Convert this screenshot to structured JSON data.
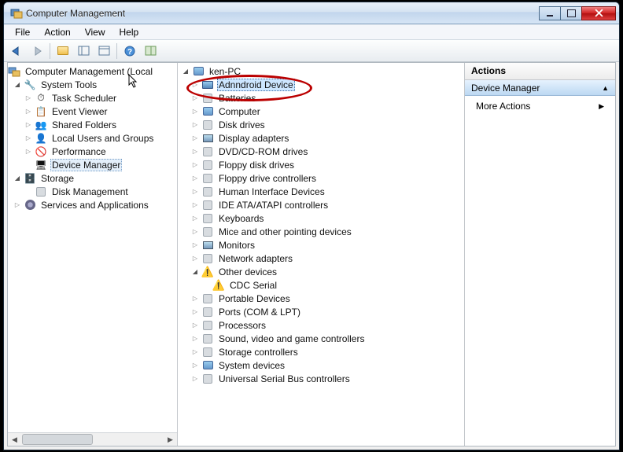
{
  "window": {
    "title": "Computer Management"
  },
  "menu": {
    "file": "File",
    "action": "Action",
    "view": "View",
    "help": "Help"
  },
  "toolbar_icons": [
    "back",
    "forward",
    "up",
    "show-hide",
    "properties",
    "refresh",
    "help",
    "topic-help"
  ],
  "left_tree": {
    "root": "Computer Management (Local",
    "system_tools": "System Tools",
    "system_children": [
      "Task Scheduler",
      "Event Viewer",
      "Shared Folders",
      "Local Users and Groups",
      "Performance",
      "Device Manager"
    ],
    "storage": "Storage",
    "disk_mgmt": "Disk Management",
    "services": "Services and Applications"
  },
  "mid_tree": {
    "root": "ken-PC",
    "categories": [
      {
        "name": "Adnndroid Device",
        "key": "android",
        "icon": "device",
        "selected": true,
        "exp": "closed"
      },
      {
        "name": "Batteries",
        "key": "batteries",
        "icon": "generic",
        "exp": "closed"
      },
      {
        "name": "Computer",
        "key": "computer",
        "icon": "computer",
        "exp": "closed"
      },
      {
        "name": "Disk drives",
        "key": "disk",
        "icon": "generic",
        "exp": "closed"
      },
      {
        "name": "Display adapters",
        "key": "display",
        "icon": "monitor",
        "exp": "closed"
      },
      {
        "name": "DVD/CD-ROM drives",
        "key": "dvd",
        "icon": "generic",
        "exp": "closed"
      },
      {
        "name": "Floppy disk drives",
        "key": "floppy",
        "icon": "generic",
        "exp": "closed"
      },
      {
        "name": "Floppy drive controllers",
        "key": "floppyctl",
        "icon": "generic",
        "exp": "closed"
      },
      {
        "name": "Human Interface Devices",
        "key": "hid",
        "icon": "generic",
        "exp": "closed"
      },
      {
        "name": "IDE ATA/ATAPI controllers",
        "key": "ide",
        "icon": "generic",
        "exp": "closed"
      },
      {
        "name": "Keyboards",
        "key": "kbd",
        "icon": "generic",
        "exp": "closed"
      },
      {
        "name": "Mice and other pointing devices",
        "key": "mice",
        "icon": "generic",
        "exp": "closed"
      },
      {
        "name": "Monitors",
        "key": "monitors",
        "icon": "monitor",
        "exp": "closed"
      },
      {
        "name": "Network adapters",
        "key": "net",
        "icon": "generic",
        "exp": "closed"
      },
      {
        "name": "Other devices",
        "key": "other",
        "icon": "warn",
        "exp": "open",
        "children": [
          {
            "name": "CDC Serial",
            "icon": "warn"
          }
        ]
      },
      {
        "name": "Portable Devices",
        "key": "portable",
        "icon": "generic",
        "exp": "closed"
      },
      {
        "name": "Ports (COM & LPT)",
        "key": "ports",
        "icon": "generic",
        "exp": "closed"
      },
      {
        "name": "Processors",
        "key": "cpu",
        "icon": "generic",
        "exp": "closed"
      },
      {
        "name": "Sound, video and game controllers",
        "key": "sound",
        "icon": "generic",
        "exp": "closed"
      },
      {
        "name": "Storage controllers",
        "key": "storectl",
        "icon": "generic",
        "exp": "closed"
      },
      {
        "name": "System devices",
        "key": "sysdev",
        "icon": "computer",
        "exp": "closed"
      },
      {
        "name": "Universal Serial Bus controllers",
        "key": "usb",
        "icon": "generic",
        "exp": "closed"
      }
    ]
  },
  "actions": {
    "header": "Actions",
    "subheader": "Device Manager",
    "item": "More Actions"
  }
}
